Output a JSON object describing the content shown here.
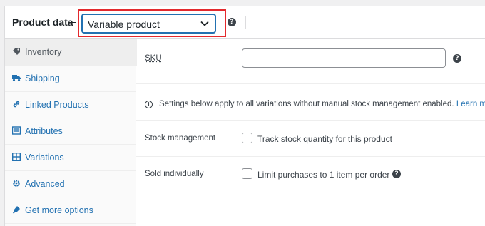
{
  "header": {
    "title": "Product data",
    "product_type": "Variable product",
    "help": "?"
  },
  "sidebar": {
    "items": [
      {
        "label": "Inventory",
        "icon": "inventory-icon",
        "active": true
      },
      {
        "label": "Shipping",
        "icon": "truck-icon",
        "active": false
      },
      {
        "label": "Linked Products",
        "icon": "link-icon",
        "active": false
      },
      {
        "label": "Attributes",
        "icon": "attributes-list-icon",
        "active": false
      },
      {
        "label": "Variations",
        "icon": "grid-icon",
        "active": false
      },
      {
        "label": "Advanced",
        "icon": "gear-icon",
        "active": false
      },
      {
        "label": "Get more options",
        "icon": "plugins-icon",
        "active": false
      }
    ]
  },
  "main": {
    "sku": {
      "label": "SKU",
      "value": ""
    },
    "notice": {
      "text": "Settings below apply to all variations without manual stock management enabled.",
      "link": "Learn more"
    },
    "stock_management": {
      "label": "Stock management",
      "checkbox_label": "Track stock quantity for this product",
      "checked": false
    },
    "sold_individually": {
      "label": "Sold individually",
      "checkbox_label": "Limit purchases to 1 item per order",
      "checked": false
    }
  },
  "colors": {
    "accent": "#2271b1",
    "highlight": "#e3292d",
    "text": "#1d2327"
  }
}
